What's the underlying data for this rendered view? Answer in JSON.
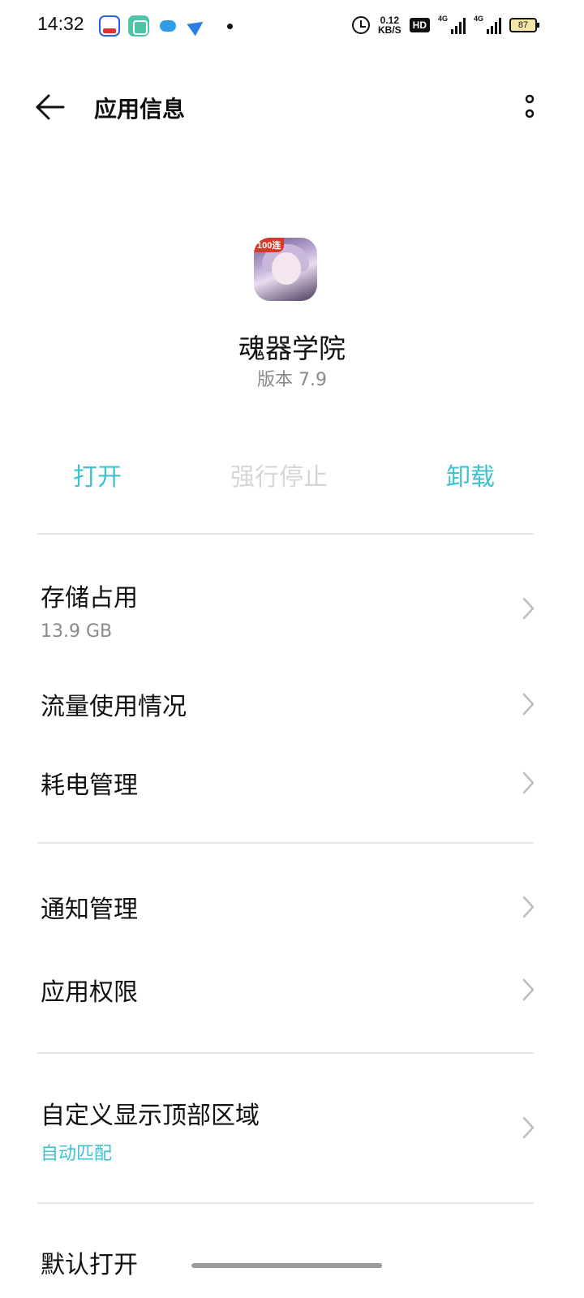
{
  "status_bar": {
    "time": "14:32",
    "net_speed_value": "0.12",
    "net_speed_unit": "KB/S",
    "hd_label": "HD",
    "signal1_label": "4G",
    "signal2_label": "4G",
    "battery": "87",
    "notification_icons": [
      "baidu-icon",
      "green-app-icon",
      "cloud-icon",
      "paper-plane-icon"
    ]
  },
  "header": {
    "title": "应用信息"
  },
  "app": {
    "badge": "100连",
    "name": "魂器学院",
    "version": "版本 7.9"
  },
  "actions": {
    "open": "打开",
    "force_stop": "强行停止",
    "uninstall": "卸载"
  },
  "list": {
    "storage": {
      "title": "存储占用",
      "subtitle": "13.9 GB"
    },
    "data_usage": {
      "title": "流量使用情况"
    },
    "battery_mgmt": {
      "title": "耗电管理"
    },
    "notifications": {
      "title": "通知管理"
    },
    "permissions": {
      "title": "应用权限"
    },
    "display_area": {
      "title": "自定义显示顶部区域",
      "subtitle": "自动匹配"
    },
    "default_open": {
      "title": "默认打开"
    }
  },
  "colors": {
    "accent": "#3fc2cf",
    "disabled": "#d6d6d6",
    "secondary_text": "#8a8a8a",
    "divider": "#e6e6e6"
  }
}
